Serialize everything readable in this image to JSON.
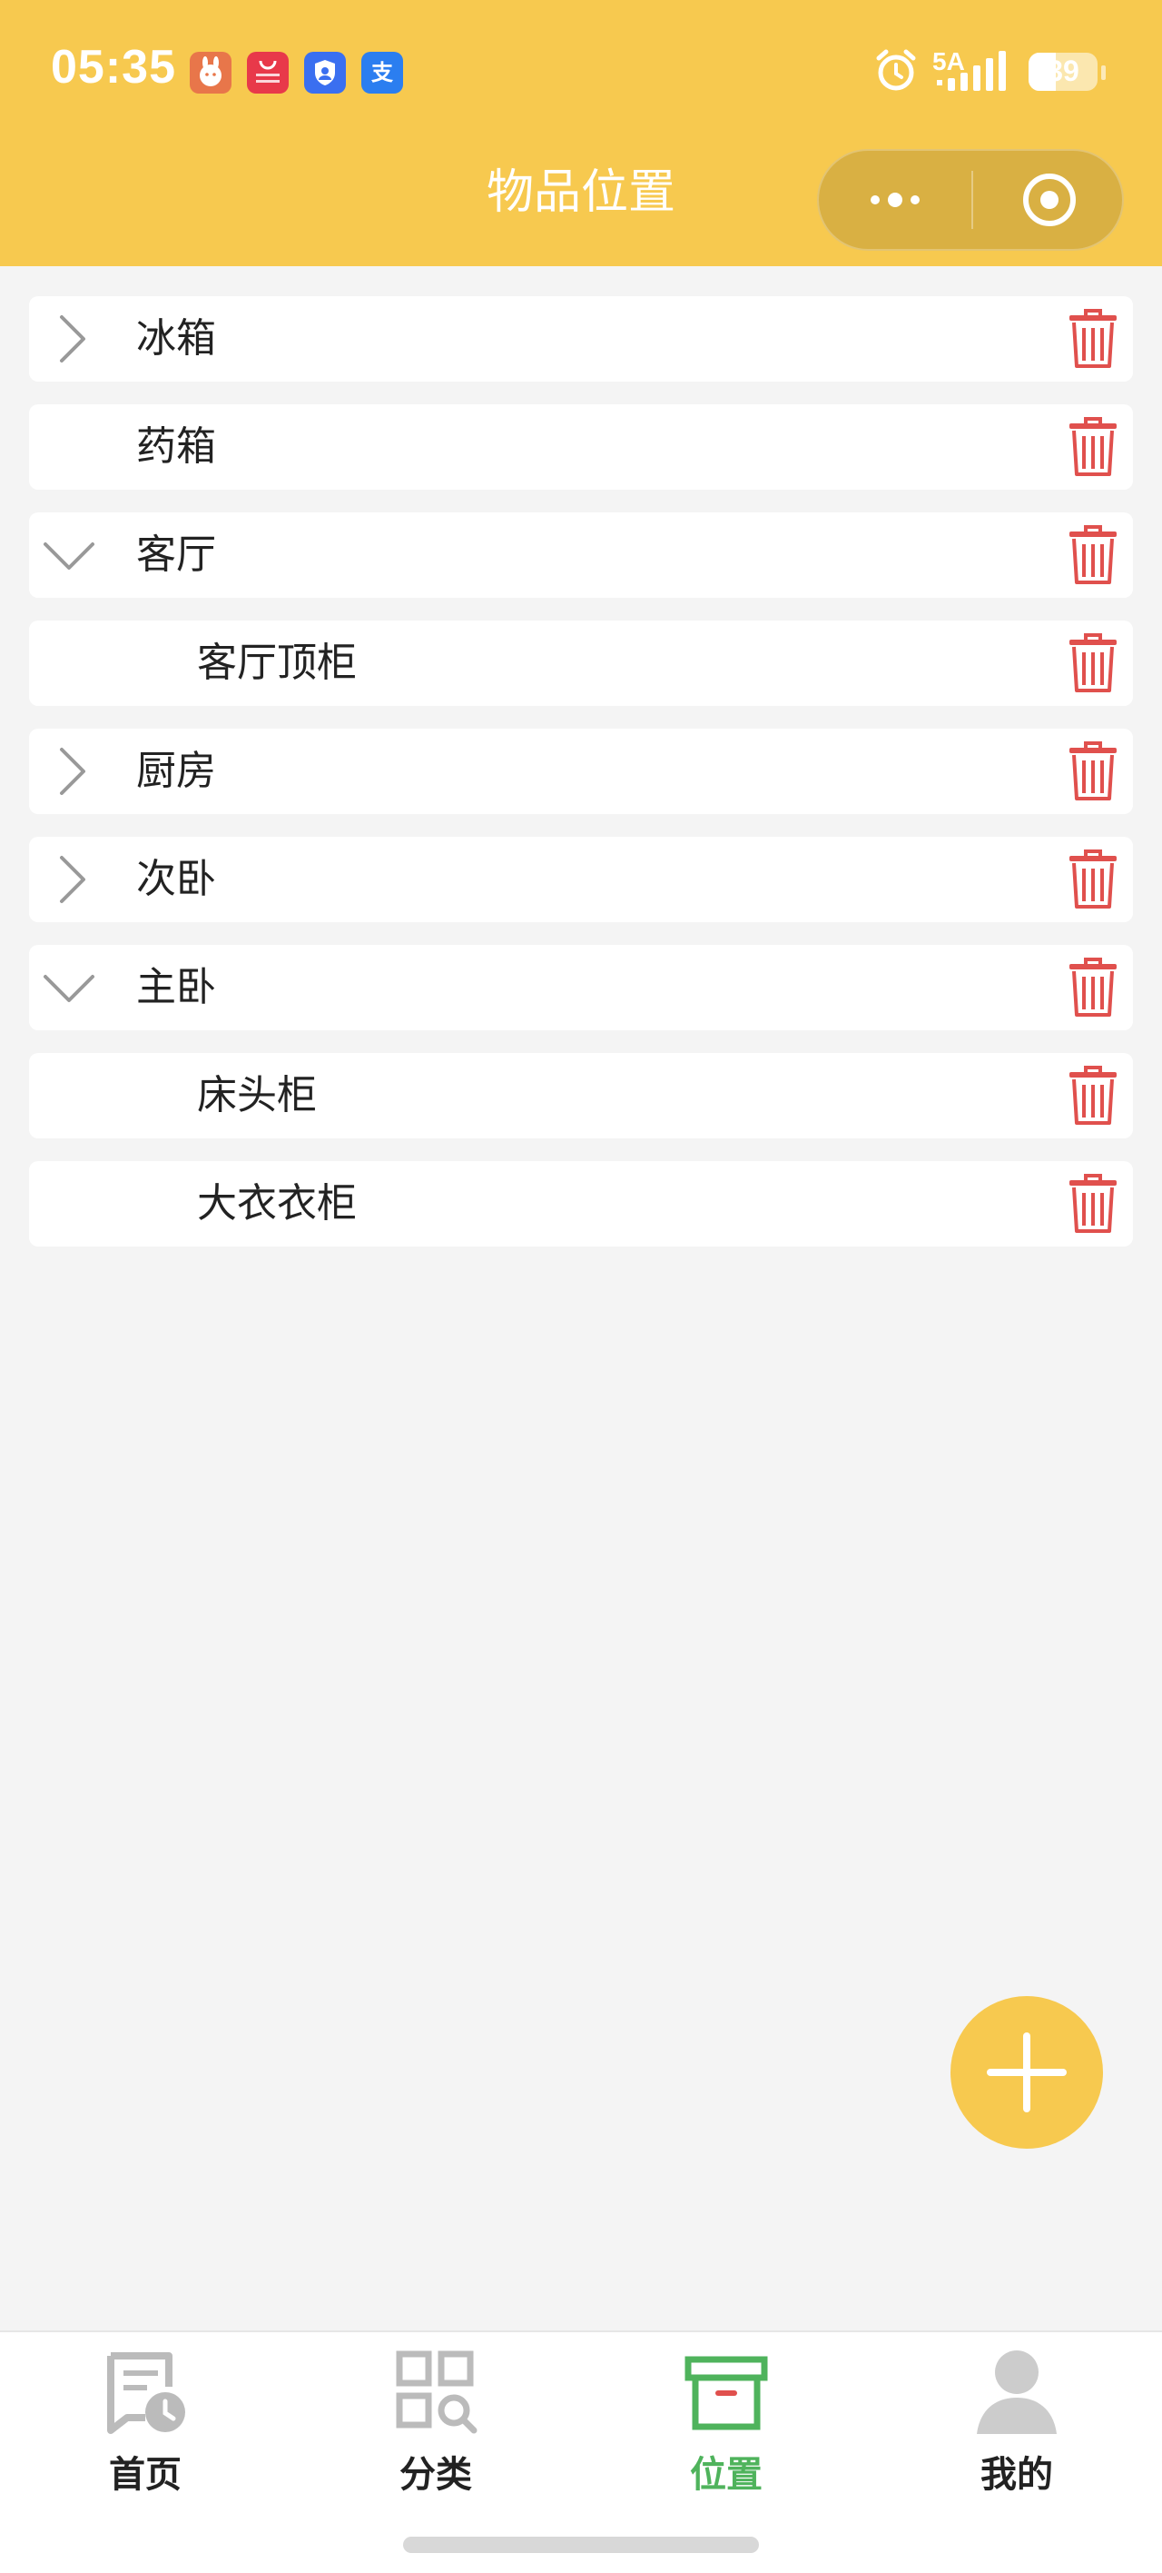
{
  "status_bar": {
    "time": "05:35",
    "network": "5A",
    "battery": "39",
    "battery_level": 0.39,
    "app_icons": [
      {
        "name": "rabbit-app-icon",
        "color": "#e8764a"
      },
      {
        "name": "app-gallery-icon",
        "color": "#e8394a"
      },
      {
        "name": "shield-app-icon",
        "color": "#3a6ff0"
      },
      {
        "name": "alipay-icon",
        "color": "#2b7ef0",
        "glyph": "支"
      }
    ]
  },
  "header": {
    "title": "物品位置",
    "menu_icon": "more-dots-icon",
    "close_icon": "target-circle-icon"
  },
  "locations": [
    {
      "label": "冰箱",
      "level": 0,
      "arrow": "right"
    },
    {
      "label": "药箱",
      "level": 0,
      "arrow": "none"
    },
    {
      "label": "客厅",
      "level": 0,
      "arrow": "down"
    },
    {
      "label": "客厅顶柜",
      "level": 1,
      "arrow": "none"
    },
    {
      "label": "厨房",
      "level": 0,
      "arrow": "right"
    },
    {
      "label": "次卧",
      "level": 0,
      "arrow": "right"
    },
    {
      "label": "主卧",
      "level": 0,
      "arrow": "down"
    },
    {
      "label": "床头柜",
      "level": 1,
      "arrow": "none"
    },
    {
      "label": "大衣衣柜",
      "level": 1,
      "arrow": "none"
    }
  ],
  "fab": {
    "icon": "plus-icon"
  },
  "tabbar": {
    "active": 2,
    "tabs": [
      {
        "label": "首页",
        "icon": "home-clock-icon"
      },
      {
        "label": "分类",
        "icon": "category-grid-icon"
      },
      {
        "label": "位置",
        "icon": "box-icon"
      },
      {
        "label": "我的",
        "icon": "user-icon"
      }
    ]
  },
  "colors": {
    "primary": "#f7c94f",
    "active_tab": "#4fb35c",
    "delete": "#e0504d",
    "arrow": "#999999"
  }
}
